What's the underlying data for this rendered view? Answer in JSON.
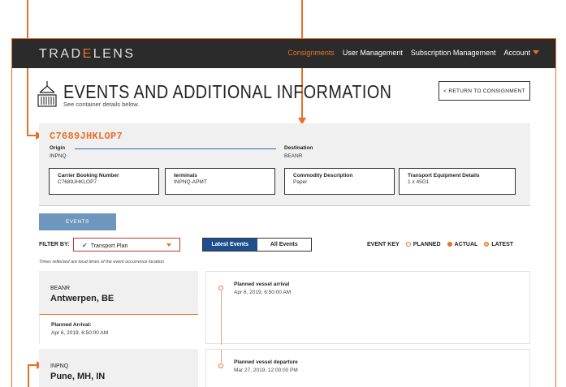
{
  "nav": {
    "logo_pre": "TRAD",
    "logo_e": "E",
    "logo_post": "LENS",
    "links": [
      "Consignments",
      "User Management",
      "Subscription Management",
      "Account"
    ]
  },
  "header": {
    "title": "EVENTS AND ADDITIONAL INFORMATION",
    "subtitle": "See container details below.",
    "return_label": "< RETURN TO CONSIGNMENT"
  },
  "container": {
    "id": "C7689JHKLOP7",
    "origin_label": "Origin",
    "origin_value": "INPNQ",
    "destination_label": "Destination",
    "destination_value": "BEANR",
    "details": [
      {
        "label": "Carrier Booking Number",
        "value": "C7689JHKLOP7"
      },
      {
        "label": "terminals",
        "value": "INPNQ-APMT"
      },
      {
        "label": "Commodity Description",
        "value": "Paper"
      },
      {
        "label": "Transport Equipment Details",
        "value": "1 x 45G1"
      }
    ]
  },
  "tabs": {
    "events": "EVENTS"
  },
  "filter": {
    "label": "FILTER BY:",
    "selected": "Transport Plan",
    "toggle_latest": "Latest Events",
    "toggle_all": "All Events"
  },
  "event_key": {
    "label": "EVENT KEY",
    "planned": "PLANNED",
    "actual": "ACTUAL",
    "latest": "LATEST"
  },
  "times_note": "Times reflected are local times of the event occurrence location",
  "locations": [
    {
      "code": "BEANR",
      "city": "Antwerpen, BE",
      "detail_label": "Planned Arrival:",
      "detail_value": "Apr 6, 2019, 6:50:00 AM"
    },
    {
      "code": "INPNQ",
      "city": "Pune, MH, IN"
    }
  ],
  "events": [
    {
      "title": "Planned vessel arrival",
      "date": "Apr 6, 2019, 6:50:00 AM"
    },
    {
      "title": "Planned vessel departure",
      "date": "Mar 27, 2019, 12:00:00 PM"
    }
  ],
  "colors": {
    "accent": "#e8702a",
    "navy": "#1f4e8c",
    "tab": "#6e97bd",
    "nav_bg": "#2b2b2b"
  }
}
